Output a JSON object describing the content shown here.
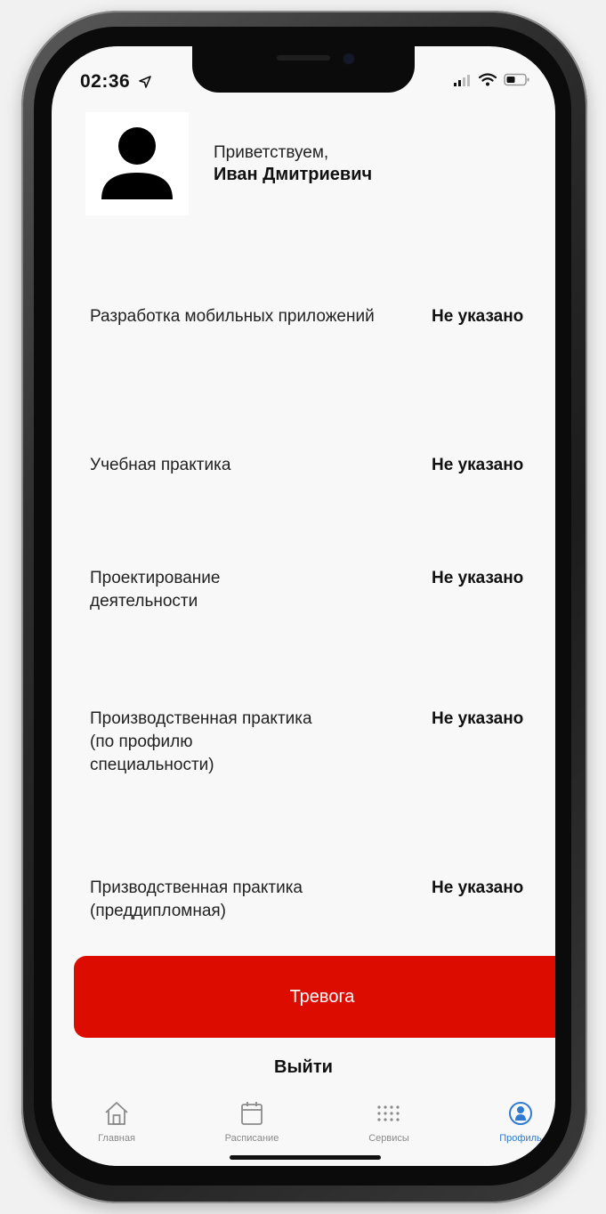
{
  "status_bar": {
    "time": "02:36",
    "icons": [
      "location-arrow-icon",
      "cellular-signal-icon",
      "wifi-icon",
      "battery-icon"
    ]
  },
  "profile": {
    "greeting": "Приветствуем,",
    "name": "Иван Дмитриевич",
    "avatar_icon": "person-icon"
  },
  "subjects": [
    {
      "label": "Разработка мобильных приложений",
      "value": "Не указано"
    },
    {
      "label": "Учебная практика",
      "value": "Не указано"
    },
    {
      "label": "Проектирование деятельности",
      "value": "Не указано"
    },
    {
      "label": "Производственная практика (по профилю специальности)",
      "value": "Не указано"
    },
    {
      "label": "Призводственная практика (преддипломная)",
      "value": "Не указано"
    }
  ],
  "actions": {
    "alarm_label": "Тревога",
    "logout_label": "Выйти"
  },
  "tabbar": {
    "tabs": [
      {
        "label": "Главная",
        "icon": "home-icon",
        "active": false
      },
      {
        "label": "Расписание",
        "icon": "calendar-icon",
        "active": false
      },
      {
        "label": "Сервисы",
        "icon": "grid-icon",
        "active": false
      },
      {
        "label": "Профиль",
        "icon": "profile-icon",
        "active": true
      }
    ]
  },
  "colors": {
    "alarm": "#dd0c00",
    "active_tab": "#2f7bd1",
    "inactive_tab": "#8a8a8a",
    "background": "#f8f8f8"
  }
}
